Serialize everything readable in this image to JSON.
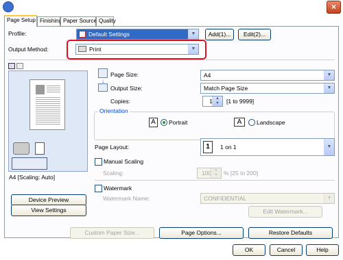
{
  "window": {
    "close_label": "×"
  },
  "tabs": [
    "Page Setup",
    "Finishing",
    "Paper Source",
    "Quality"
  ],
  "profile": {
    "label": "Profile:",
    "value": "Default Settings",
    "add": "Add(1)...",
    "edit": "Edit(2)..."
  },
  "output_method": {
    "label": "Output Method:",
    "value": "Print"
  },
  "preview": {
    "caption": "A4 [Scaling: Auto]",
    "device_preview": "Device Preview",
    "view_settings": "View Settings"
  },
  "page_size": {
    "label": "Page Size:",
    "value": "A4"
  },
  "output_size": {
    "label": "Output Size:",
    "value": "Match Page Size"
  },
  "copies": {
    "label": "Copies:",
    "value": "1",
    "range": "[1 to 9999]"
  },
  "orientation": {
    "label": "Orientation",
    "portrait": "Portrait",
    "landscape": "Landscape",
    "portrait_icon": "A",
    "landscape_icon": "A",
    "selected": "Portrait"
  },
  "page_layout": {
    "label": "Page Layout:",
    "value": "1 on 1",
    "badge": "1"
  },
  "manual_scaling": {
    "label": "Manual Scaling",
    "scaling_label": "Scaling:",
    "value": "100",
    "range": "% [25 to 200]"
  },
  "watermark": {
    "label": "Watermark",
    "name_label": "Watermark Name:",
    "value": "CONFIDENTIAL",
    "edit": "Edit Watermark..."
  },
  "bottom": {
    "custom_paper": "Custom Paper Size...",
    "page_options": "Page Options...",
    "restore": "Restore Defaults"
  },
  "footer": {
    "ok": "OK",
    "cancel": "Cancel",
    "help": "Help"
  }
}
